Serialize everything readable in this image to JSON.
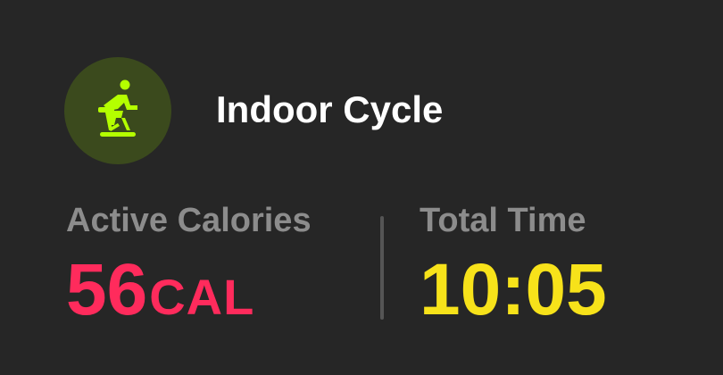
{
  "workout": {
    "title": "Indoor Cycle",
    "icon": "indoor-cycle-icon"
  },
  "metrics": {
    "active_calories": {
      "label": "Active Calories",
      "value": "56",
      "unit": "CAL"
    },
    "total_time": {
      "label": "Total Time",
      "value": "10:05"
    }
  },
  "colors": {
    "background": "#262626",
    "icon_bg": "#3b4a1d",
    "icon_accent": "#b4ff00",
    "calories": "#ff2b5c",
    "time": "#f7e21a",
    "label": "#8c8c8c"
  }
}
